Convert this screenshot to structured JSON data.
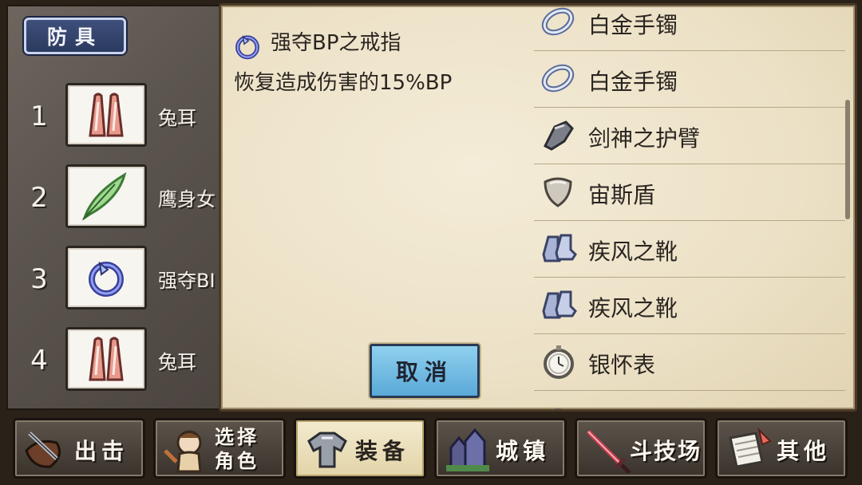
{
  "left_panel": {
    "section_tab": "防具",
    "slots": [
      {
        "number": "1",
        "label": "兔耳",
        "icon": "bunny-ears-icon"
      },
      {
        "number": "2",
        "label": "鹰身女",
        "icon": "green-feather-icon"
      },
      {
        "number": "3",
        "label": "强夺BI",
        "icon": "blue-ring-icon"
      },
      {
        "number": "4",
        "label": "兔耳",
        "icon": "bunny-ears-icon"
      }
    ]
  },
  "popup": {
    "item_name": "强夺BP之戒指",
    "item_icon": "blue-ring-icon",
    "item_description": "恢复造成伤害的15%BP",
    "cancel_label": "取消",
    "equipment_list": [
      {
        "label": "白金手镯",
        "icon": "platinum-bracelet-icon"
      },
      {
        "label": "白金手镯",
        "icon": "platinum-bracelet-icon"
      },
      {
        "label": "剑神之护臂",
        "icon": "gauntlet-icon"
      },
      {
        "label": "宙斯盾",
        "icon": "shield-icon"
      },
      {
        "label": "疾风之靴",
        "icon": "boots-icon"
      },
      {
        "label": "疾风之靴",
        "icon": "boots-icon"
      },
      {
        "label": "银怀表",
        "icon": "pocket-watch-icon"
      },
      {
        "label": "",
        "icon": "partial-item-icon"
      }
    ]
  },
  "bottom_nav": [
    {
      "label": "出击",
      "icon": "sortie-icon"
    },
    {
      "label": "选择角色",
      "line1": "选择",
      "line2": "角色",
      "icon": "character-icon"
    },
    {
      "label": "装备",
      "icon": "armor-icon",
      "active": true
    },
    {
      "label": "城镇",
      "icon": "town-icon"
    },
    {
      "label": "斗技场",
      "icon": "arena-sword-icon"
    },
    {
      "label": "其他",
      "icon": "other-scroll-icon"
    }
  ],
  "colors": {
    "parchment": "#efe5cc",
    "tab_blue": "#2b3a5f",
    "cancel_blue": "#6bb6e0",
    "active_nav": "#ece0b9"
  }
}
